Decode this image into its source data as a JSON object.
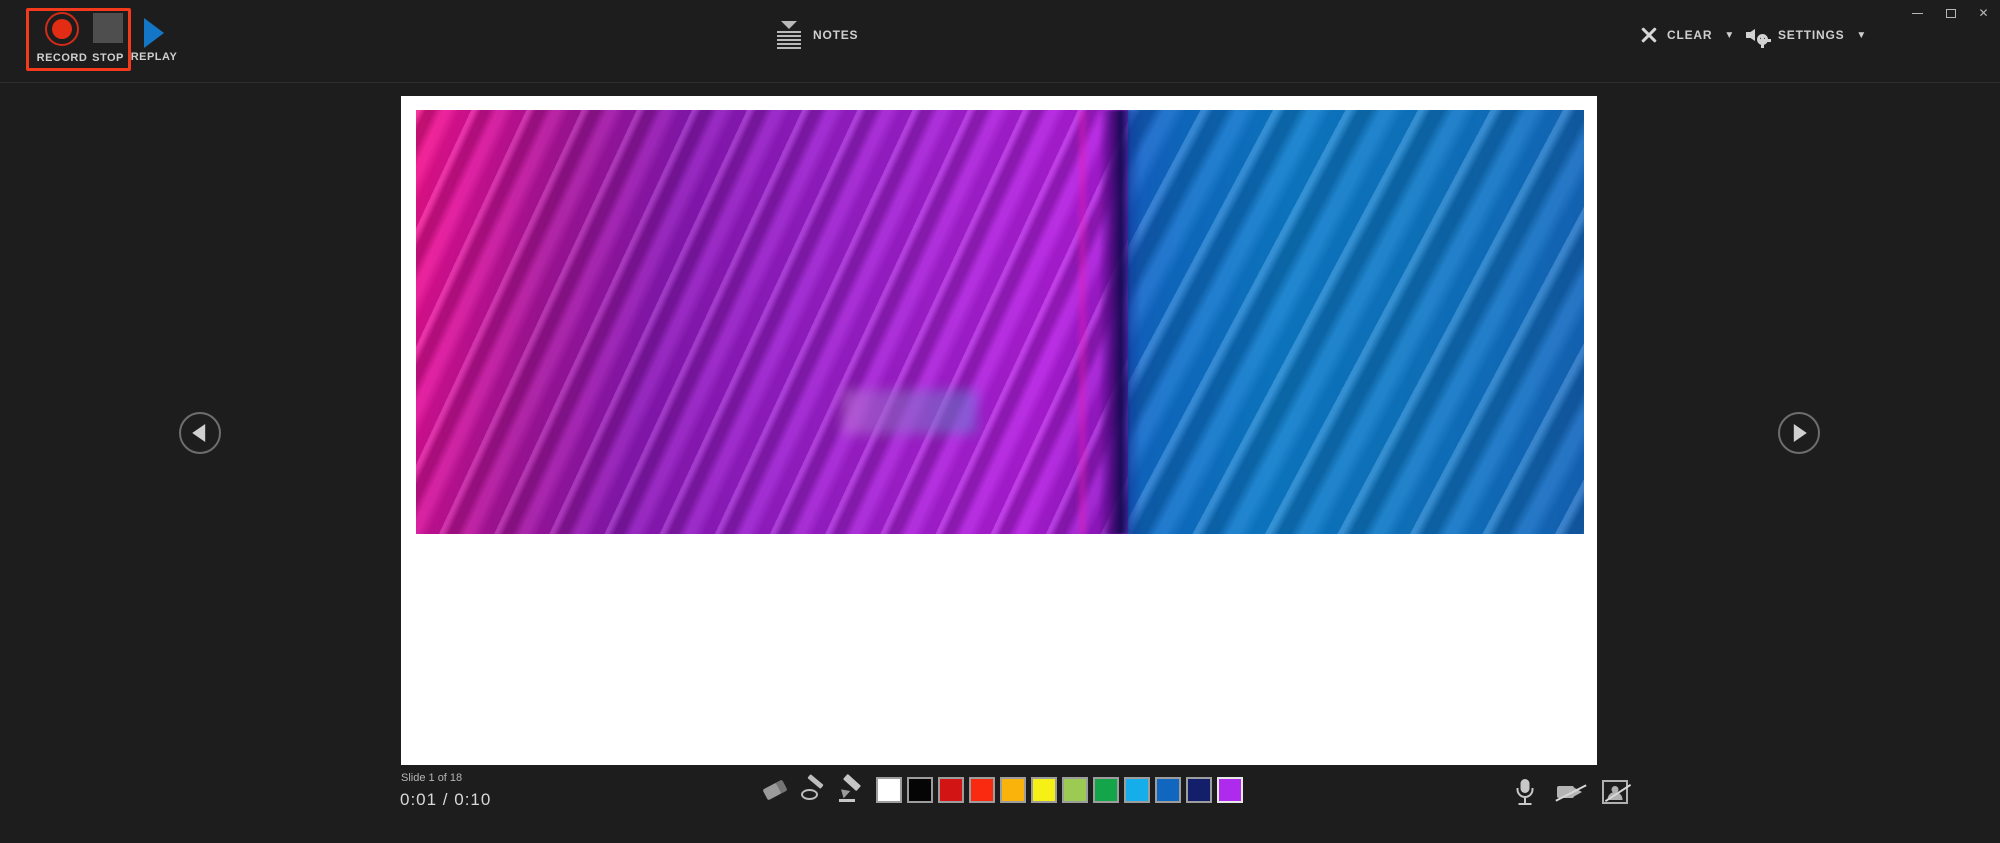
{
  "window": {
    "controls": [
      {
        "name": "minimize",
        "label": "–"
      },
      {
        "name": "restore",
        "label": "❐"
      },
      {
        "name": "close",
        "label": "✕"
      }
    ]
  },
  "toolbar_top": {
    "record_label": "RECORD",
    "stop_label": "STOP",
    "replay_label": "REPLAY",
    "notes_label": "NOTES",
    "clear_label": "CLEAR",
    "clear_caret": "▼",
    "settings_label": "SETTINGS",
    "settings_caret": "▼",
    "record_highlight_color": "#f43a1c",
    "record_dot_color": "#e32c14",
    "stop_square_color": "#4e4e4e",
    "replay_triangle_color": "#1476c6"
  },
  "slide": {
    "counter": "Slide 1 of 18",
    "timer": "0:01 / 0:10",
    "nav_prev_label": "Previous slide",
    "nav_next_label": "Next slide",
    "image_description": "Colorful feather macro, magenta-to-purple on the left and blue on the right"
  },
  "ink_toolbar": {
    "tools": [
      {
        "name": "eraser",
        "label": "Eraser"
      },
      {
        "name": "lasso-select",
        "label": "Lasso Select"
      },
      {
        "name": "pen",
        "label": "Pen"
      }
    ],
    "colors": [
      {
        "name": "white",
        "hex": "#ffffff",
        "selected": false
      },
      {
        "name": "black",
        "hex": "#050505",
        "selected": false
      },
      {
        "name": "dark-red",
        "hex": "#d21414",
        "selected": false
      },
      {
        "name": "red",
        "hex": "#f92a10",
        "selected": false
      },
      {
        "name": "orange",
        "hex": "#f9b30b",
        "selected": false
      },
      {
        "name": "yellow",
        "hex": "#f7f017",
        "selected": false
      },
      {
        "name": "light-green",
        "hex": "#9bcb53",
        "selected": false
      },
      {
        "name": "green",
        "hex": "#14a44a",
        "selected": false
      },
      {
        "name": "light-blue",
        "hex": "#15aeea",
        "selected": false
      },
      {
        "name": "blue",
        "hex": "#1166c0",
        "selected": false
      },
      {
        "name": "dark-blue",
        "hex": "#131f6b",
        "selected": false
      },
      {
        "name": "purple",
        "hex": "#ae2aec",
        "selected": true
      }
    ]
  },
  "devices": [
    {
      "name": "microphone",
      "label": "Microphone",
      "state": "on"
    },
    {
      "name": "camera-off",
      "label": "Camera off",
      "state": "off"
    },
    {
      "name": "presenter-view-off",
      "label": "Presenter view off",
      "state": "off"
    }
  ]
}
